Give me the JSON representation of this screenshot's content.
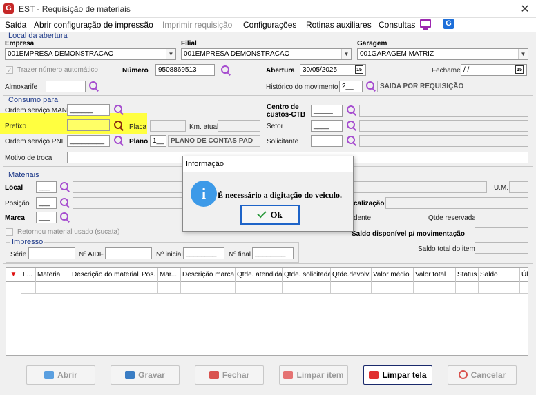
{
  "window": {
    "title": "EST - Requisição de materiais",
    "close_glyph": "✕",
    "app_icon_glyph": "G",
    "app_icon_color": "#c62828"
  },
  "menu": {
    "items": [
      "Saída",
      "Abrir configuração de impressão",
      "Imprimir requisição",
      "Configurações",
      "Rotinas auxiliares",
      "Consultas"
    ],
    "disabled_item": "Imprimir requisição",
    "icons": [
      "monitor-icon",
      "g-icon"
    ],
    "g_glyph": "G"
  },
  "abertura": {
    "group_title": "Local da abertura",
    "empresa_label": "Empresa",
    "empresa_value": "001EMPRESA DEMONSTRACAO",
    "filial_label": "Filial",
    "filial_value": "001EMPRESA DEMONSTRACAO",
    "garagem_label": "Garagem",
    "garagem_value": "001GARAGEM MATRIZ",
    "trazer_label": "Trazer número automático",
    "trazer_check": "✓",
    "numero_label": "Número",
    "numero_value": "9508869513",
    "abertura_label": "Abertura",
    "abertura_value": "30/05/2025",
    "fechamento_label": "Fechamento",
    "fechamento_value": "/ /",
    "cal_glyph": "15",
    "almoxarife_label": "Almoxarife",
    "almoxarife_value": "",
    "historico_label": "Histórico do movimento",
    "historico_code": "2__",
    "historico_desc": "SAIDA POR REQUISIÇÃO"
  },
  "consumo": {
    "group_title": "Consumo para",
    "os_man_label": "Ordem serviço MAN",
    "os_man_value": "______",
    "prefixo_label": "Prefixo",
    "prefixo_value": "",
    "placa_label": "Placa",
    "km_label": "Km. atual",
    "os_pne_label": "Ordem serviço PNE",
    "os_pne_value": "_________",
    "plano_label": "Plano",
    "plano_code": "1__",
    "plano_desc": "PLANO DE CONTAS PAD",
    "centro_label": "Centro de custos-CTB",
    "centro_value": "_____",
    "setor_label": "Setor",
    "setor_value": "____",
    "solicitante_label": "Solicitante",
    "solicitante_value": "",
    "motivo_label": "Motivo de troca"
  },
  "materiais": {
    "group_title": "Materiais",
    "local_label": "Local",
    "local_value": "___",
    "posicao_label": "Posição",
    "posicao_value": "___",
    "marca_label": "Marca",
    "marca_value": "___",
    "retornou_label": "Retornou material usado (sucata)",
    "um_label": "U.M.",
    "localizacao_label": "calização",
    "pendente_label": "dente",
    "qtde_reservada_label": "Qtde reservada",
    "saldo_disp_label": "Saldo disponível p/ movimentação",
    "saldo_total_label": "Saldo total do item"
  },
  "impresso": {
    "group_title": "Impresso",
    "serie_label": "Série",
    "aidf_label": "Nº AIDF",
    "inicial_label": "Nº inicial",
    "inicial_value": "________",
    "final_label": "Nº final",
    "final_value": "________"
  },
  "grid": {
    "sort_glyph": "▼",
    "columns": [
      "L...",
      "Material",
      "Descrição do material",
      "Pos.",
      "Mar...",
      "Descrição marca",
      "Qtde. atendida",
      "Qtde. solicitada",
      "Qtde.devolv.",
      "Valor médio",
      "Valor total",
      "Status",
      "Saldo",
      "Úl"
    ]
  },
  "buttons": {
    "abrir": "Abrir",
    "gravar": "Gravar",
    "fechar": "Fechar",
    "limpar_item": "Limpar item",
    "limpar_tela": "Limpar tela",
    "cancelar": "Cancelar"
  },
  "dialog": {
    "title": "Informação",
    "icon_glyph": "i",
    "message": "É necessário a digitação do veiculo.",
    "ok_label": "Ok"
  },
  "colors": {
    "highlight": "#ffff40",
    "accent": "#1e64c8",
    "search_icon": "#a64dcf"
  }
}
